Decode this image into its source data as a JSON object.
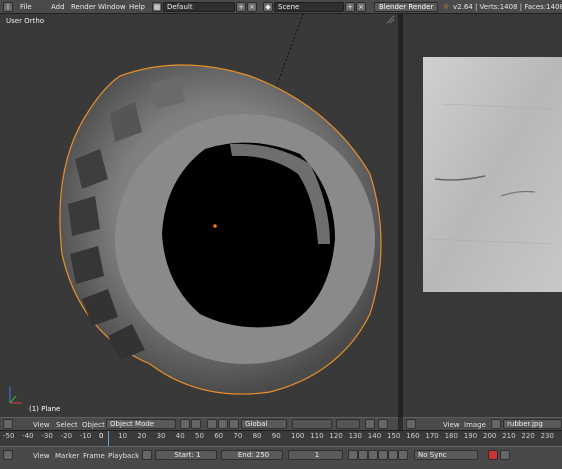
{
  "topbar": {
    "menus": [
      "File",
      "Add",
      "Render",
      "Window",
      "Help"
    ],
    "screen_layout": "Default",
    "scene": "Scene",
    "render_engine": "Blender Render",
    "stats": "v2.64 | Verts:1408 | Faces:1408 |"
  },
  "viewport": {
    "view_label": "User Ortho",
    "object_label": "(1) Plane"
  },
  "view3d_header": {
    "menus": [
      "View",
      "Select",
      "Object"
    ],
    "mode": "Object Mode",
    "orientation": "Global"
  },
  "image_header": {
    "menus": [
      "View",
      "Image"
    ],
    "image_name": "rubber.jpg"
  },
  "timeline": {
    "ticks": [
      "-50",
      "-40",
      "-30",
      "-20",
      "-10",
      "0",
      "10",
      "20",
      "30",
      "40",
      "50",
      "60",
      "70",
      "80",
      "90",
      "100",
      "110",
      "120",
      "130",
      "140",
      "150",
      "160",
      "170",
      "180",
      "190",
      "200",
      "210",
      "220",
      "230"
    ],
    "current_frame_marker": "0"
  },
  "timeline_header": {
    "menus": [
      "View",
      "Marker",
      "Frame",
      "Playback"
    ],
    "start": "Start: 1",
    "end": "End: 250",
    "current": "1",
    "sync": "No Sync"
  },
  "colors": {
    "selection_outline": "#e8902a",
    "origin_dot": "#ff7a1a",
    "current_frame": "#5aa8e8"
  }
}
